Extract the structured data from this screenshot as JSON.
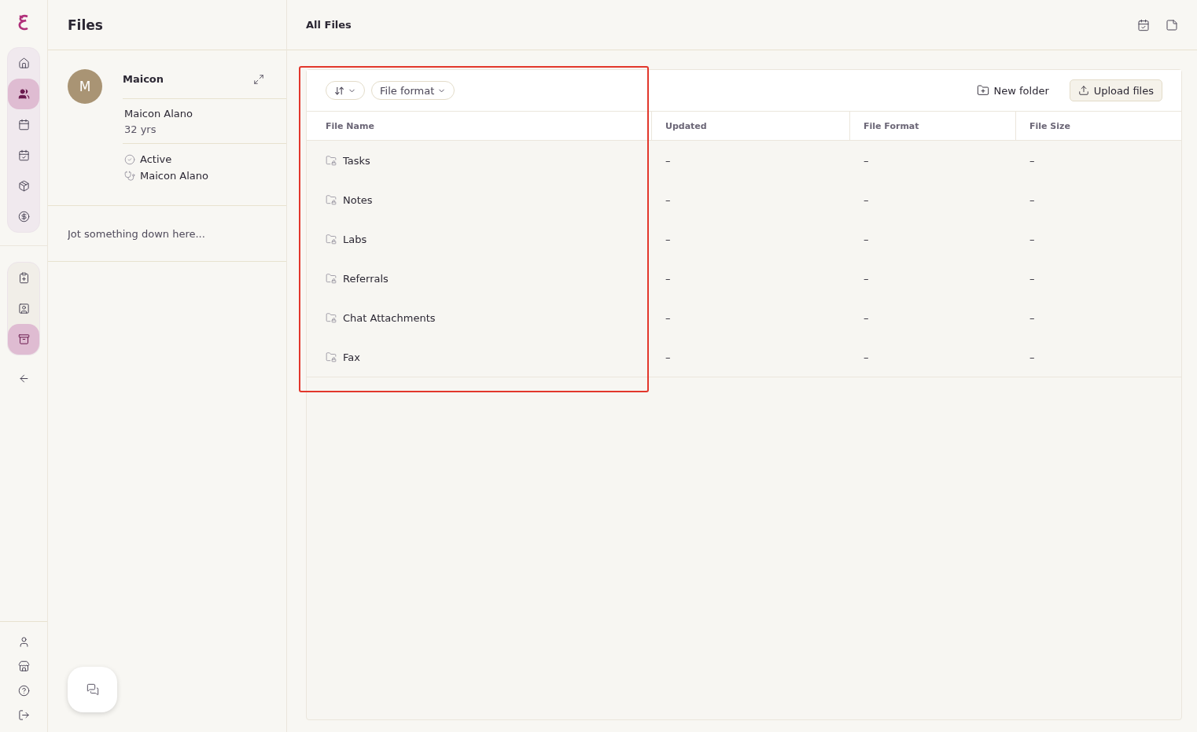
{
  "nav": {
    "primary": [
      {
        "selected": false
      },
      {
        "selected": true
      },
      {
        "selected": false
      },
      {
        "selected": false
      },
      {
        "selected": false
      },
      {
        "selected": false
      }
    ],
    "secondary": [
      {
        "selected": false
      },
      {
        "selected": false
      },
      {
        "selected": true
      }
    ]
  },
  "side_panel": {
    "title": "Files",
    "patient": {
      "initial": "M",
      "short_name": "Maicon",
      "full_name": "Maicon Alano",
      "age": "32 yrs",
      "status": "Active",
      "provider": "Maicon Alano"
    },
    "notes": {
      "placeholder": "Jot something down here..."
    }
  },
  "main": {
    "title": "All Files",
    "toolbar": {
      "filter": "File format",
      "new_folder": "New folder",
      "upload": "Upload files"
    },
    "table": {
      "columns": [
        "File Name",
        "Updated",
        "File Format",
        "File Size"
      ],
      "rows": [
        {
          "name": "Tasks",
          "updated": "–",
          "format": "–",
          "size": "–"
        },
        {
          "name": "Notes",
          "updated": "–",
          "format": "–",
          "size": "–"
        },
        {
          "name": "Labs",
          "updated": "–",
          "format": "–",
          "size": "–"
        },
        {
          "name": "Referrals",
          "updated": "–",
          "format": "–",
          "size": "–"
        },
        {
          "name": "Chat Attachments",
          "updated": "–",
          "format": "–",
          "size": "–"
        },
        {
          "name": "Fax",
          "updated": "–",
          "format": "–",
          "size": "–"
        }
      ]
    }
  }
}
